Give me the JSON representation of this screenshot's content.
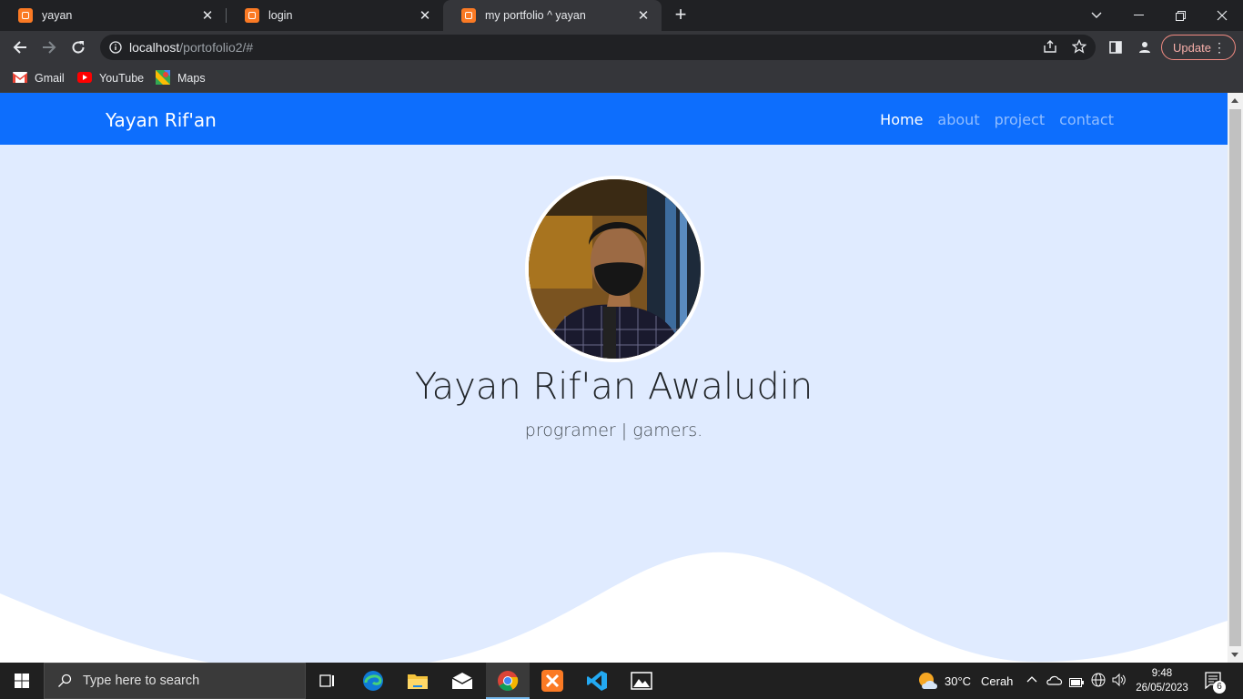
{
  "browser": {
    "tabs": [
      {
        "title": "yayan",
        "active": false
      },
      {
        "title": "login",
        "active": false
      },
      {
        "title": "my portfolio ^ yayan",
        "active": true
      }
    ],
    "url_host": "localhost",
    "url_path": "/portofolio2/#",
    "update_label": "Update",
    "bookmarks": [
      {
        "label": "Gmail",
        "icon": "gmail-icon"
      },
      {
        "label": "YouTube",
        "icon": "youtube-icon"
      },
      {
        "label": "Maps",
        "icon": "maps-icon"
      }
    ]
  },
  "page": {
    "brand": "Yayan Rif'an",
    "nav": [
      {
        "label": "Home",
        "active": true
      },
      {
        "label": "about",
        "active": false
      },
      {
        "label": "project",
        "active": false
      },
      {
        "label": "contact",
        "active": false
      }
    ],
    "hero_name": "Yayan Rif'an Awaludin",
    "hero_subtitle": "programer | gamers.",
    "colors": {
      "navbar": "#0d6efd",
      "hero_bg": "#e0ebff",
      "wave": "#ffffff"
    }
  },
  "taskbar": {
    "search_placeholder": "Type here to search",
    "weather_temp": "30°C",
    "weather_desc": "Cerah",
    "time": "9:48",
    "date": "26/05/2023",
    "notification_count": "6"
  }
}
